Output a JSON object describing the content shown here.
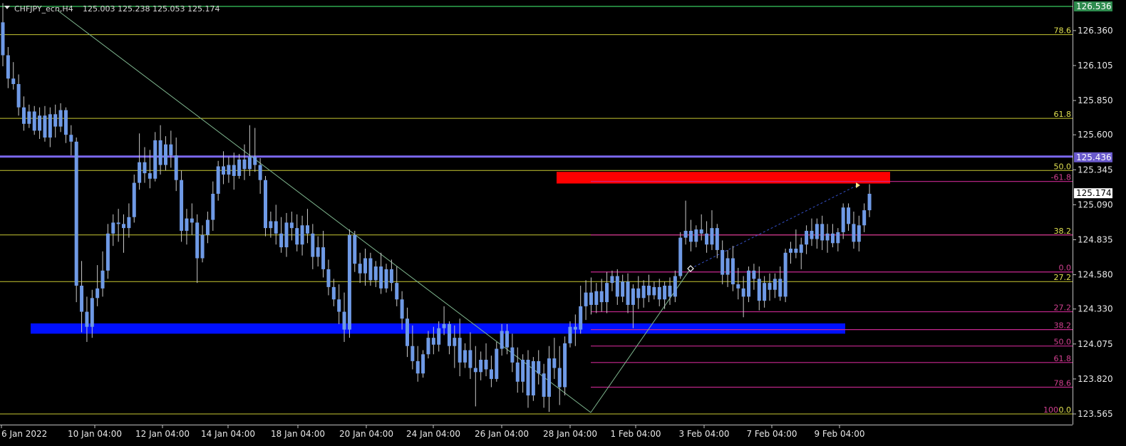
{
  "header": {
    "symbol_label": "CHFJPY_ecn,H4",
    "ohlc_label": "125.003 125.238 125.053 125.174"
  },
  "colors": {
    "background": "#000000",
    "candle_body": "#6f9ae6",
    "candle_wick": "#c8c8c8",
    "fib_yellow": "#c8c832",
    "fib_yellow_text": "#e0e050",
    "fib_magenta": "#c82890",
    "fib_magenta_text": "#d0408f",
    "resistance_line": "#7b68ee",
    "support_zone": "#0010ff",
    "resistance_zone": "#ff0000",
    "top_line": "#2fa84f",
    "trendline": "#7fb78f"
  },
  "price_axis": {
    "ticks": [
      "126.360",
      "126.105",
      "125.850",
      "125.600",
      "125.345",
      "125.090",
      "124.835",
      "124.580",
      "124.330",
      "124.075",
      "123.820",
      "123.565"
    ],
    "tags": [
      {
        "text": "126.536",
        "value": 126.536,
        "bg": "#2e8b4e",
        "fg": "#ffffff"
      },
      {
        "text": "125.436",
        "value": 125.436,
        "bg": "#6a5acd",
        "fg": "#ffffff"
      },
      {
        "text": "125.174",
        "value": 125.174,
        "bg": "#ffffff",
        "fg": "#000000"
      }
    ]
  },
  "time_axis": {
    "labels": [
      "6 Jan 2022",
      "10 Jan 04:00",
      "12 Jan 04:00",
      "14 Jan 04:00",
      "18 Jan 04:00",
      "20 Jan 04:00",
      "24 Jan 04:00",
      "26 Jan 04:00",
      "28 Jan 04:00",
      "1 Feb 04:00",
      "3 Feb 04:00",
      "7 Feb 04:00",
      "9 Feb 04:00"
    ]
  },
  "fib_large": {
    "levels": [
      {
        "label": "78.6",
        "value": 126.33
      },
      {
        "label": "61.8",
        "value": 125.72
      },
      {
        "label": "50.0",
        "value": 125.34
      },
      {
        "label": "38.2",
        "value": 124.87
      },
      {
        "label": "27.2",
        "value": 124.53
      },
      {
        "label": "100",
        "value": 123.565
      },
      {
        "label": "0.0",
        "value": 123.565
      }
    ]
  },
  "fib_small": {
    "levels": [
      {
        "label": "-61.8",
        "value": 125.26
      },
      {
        "label": "38.2",
        "value": 124.87
      },
      {
        "label": "0.0",
        "value": 124.6
      },
      {
        "label": "27.2",
        "value": 124.31
      },
      {
        "label": "38.2",
        "value": 124.18
      },
      {
        "label": "50.0",
        "value": 124.06
      },
      {
        "label": "61.8",
        "value": 123.94
      },
      {
        "label": "78.6",
        "value": 123.76
      }
    ]
  },
  "chart_data": {
    "type": "candlestick",
    "title": "CHFJPY_ecn,H4",
    "current_ohlc": {
      "open": 125.003,
      "high": 125.238,
      "low": 125.053,
      "close": 125.174
    },
    "ylim": [
      123.5,
      126.6
    ],
    "y_ticks": [
      126.36,
      126.105,
      125.85,
      125.6,
      125.345,
      125.09,
      124.835,
      124.58,
      124.33,
      124.075,
      123.82,
      123.565
    ],
    "x_labels": [
      "6 Jan 2022",
      "10 Jan 04:00",
      "12 Jan 04:00",
      "14 Jan 04:00",
      "18 Jan 04:00",
      "20 Jan 04:00",
      "24 Jan 04:00",
      "26 Jan 04:00",
      "28 Jan 04:00",
      "1 Feb 04:00",
      "3 Feb 04:00",
      "7 Feb 04:00",
      "9 Feb 04:00"
    ],
    "horizontal_lines": {
      "top_line": 126.536,
      "resistance_line": 125.436,
      "current_price": 125.174
    },
    "support_zone": {
      "from": 124.15,
      "to": 124.225
    },
    "resistance_zone": {
      "from": 125.245,
      "to": 125.33
    },
    "candles": [
      [
        126.42,
        126.56,
        126.1,
        126.18
      ],
      [
        126.18,
        126.24,
        125.94,
        126.01
      ],
      [
        126.01,
        126.13,
        125.93,
        125.97
      ],
      [
        125.97,
        126.04,
        125.74,
        125.8
      ],
      [
        125.8,
        125.88,
        125.63,
        125.68
      ],
      [
        125.68,
        125.82,
        125.65,
        125.77
      ],
      [
        125.77,
        125.81,
        125.6,
        125.63
      ],
      [
        125.63,
        125.8,
        125.57,
        125.74
      ],
      [
        125.74,
        125.81,
        125.55,
        125.58
      ],
      [
        125.58,
        125.8,
        125.51,
        125.75
      ],
      [
        125.75,
        125.82,
        125.58,
        125.66
      ],
      [
        125.66,
        125.83,
        125.62,
        125.78
      ],
      [
        125.78,
        125.8,
        125.54,
        125.6
      ],
      [
        125.6,
        125.67,
        125.45,
        125.55
      ],
      [
        125.55,
        125.58,
        124.38,
        124.5
      ],
      [
        124.5,
        124.68,
        124.16,
        124.31
      ],
      [
        124.31,
        124.42,
        124.09,
        124.2
      ],
      [
        124.2,
        124.47,
        124.12,
        124.41
      ],
      [
        124.41,
        124.65,
        124.35,
        124.48
      ],
      [
        124.48,
        124.75,
        124.42,
        124.61
      ],
      [
        124.61,
        124.95,
        124.55,
        124.88
      ],
      [
        124.88,
        125.02,
        124.79,
        124.96
      ],
      [
        124.96,
        125.06,
        124.82,
        124.95
      ],
      [
        124.95,
        125.02,
        124.74,
        124.92
      ],
      [
        124.92,
        125.1,
        124.85,
        125.0
      ],
      [
        125.0,
        125.31,
        124.96,
        125.25
      ],
      [
        125.25,
        125.61,
        125.2,
        125.4
      ],
      [
        125.4,
        125.51,
        125.25,
        125.32
      ],
      [
        125.32,
        125.49,
        125.21,
        125.28
      ],
      [
        125.28,
        125.62,
        125.26,
        125.56
      ],
      [
        125.56,
        125.67,
        125.31,
        125.38
      ],
      [
        125.38,
        125.59,
        125.34,
        125.53
      ],
      [
        125.53,
        125.63,
        125.36,
        125.45
      ],
      [
        125.45,
        125.58,
        125.19,
        125.27
      ],
      [
        125.27,
        125.34,
        124.82,
        124.9
      ],
      [
        124.9,
        125.06,
        124.8,
        124.99
      ],
      [
        124.99,
        125.1,
        124.87,
        124.96
      ],
      [
        124.96,
        125.02,
        124.52,
        124.7
      ],
      [
        124.7,
        124.94,
        124.67,
        124.87
      ],
      [
        124.87,
        125.04,
        124.81,
        124.98
      ],
      [
        124.98,
        125.26,
        124.9,
        125.17
      ],
      [
        125.17,
        125.41,
        125.12,
        125.37
      ],
      [
        125.37,
        125.48,
        125.24,
        125.31
      ],
      [
        125.31,
        125.44,
        125.25,
        125.38
      ],
      [
        125.38,
        125.47,
        125.2,
        125.3
      ],
      [
        125.3,
        125.46,
        125.28,
        125.42
      ],
      [
        125.42,
        125.53,
        125.27,
        125.35
      ],
      [
        125.35,
        125.67,
        125.3,
        125.44
      ],
      [
        125.44,
        125.65,
        125.33,
        125.38
      ],
      [
        125.38,
        125.43,
        125.17,
        125.27
      ],
      [
        125.27,
        125.3,
        124.86,
        124.92
      ],
      [
        124.92,
        125.04,
        124.85,
        124.97
      ],
      [
        124.97,
        125.09,
        124.8,
        124.88
      ],
      [
        124.88,
        125.0,
        124.74,
        124.78
      ],
      [
        124.78,
        125.03,
        124.71,
        124.96
      ],
      [
        124.96,
        125.04,
        124.83,
        124.92
      ],
      [
        124.92,
        125.02,
        124.75,
        124.8
      ],
      [
        124.8,
        125.01,
        124.72,
        124.94
      ],
      [
        124.94,
        125.06,
        124.81,
        124.88
      ],
      [
        124.88,
        124.95,
        124.62,
        124.71
      ],
      [
        124.71,
        124.86,
        124.64,
        124.78
      ],
      [
        124.78,
        124.9,
        124.56,
        124.62
      ],
      [
        124.62,
        124.69,
        124.43,
        124.49
      ],
      [
        124.49,
        124.55,
        124.35,
        124.4
      ],
      [
        124.4,
        124.51,
        124.22,
        124.31
      ],
      [
        124.31,
        124.45,
        124.09,
        124.18
      ],
      [
        124.18,
        124.91,
        124.12,
        124.87
      ],
      [
        124.87,
        124.9,
        124.6,
        124.66
      ],
      [
        124.66,
        124.74,
        124.52,
        124.59
      ],
      [
        124.59,
        124.77,
        124.5,
        124.7
      ],
      [
        124.7,
        124.74,
        124.5,
        124.54
      ],
      [
        124.54,
        124.68,
        124.49,
        124.64
      ],
      [
        124.64,
        124.74,
        124.44,
        124.48
      ],
      [
        124.48,
        124.66,
        124.45,
        124.62
      ],
      [
        124.62,
        124.69,
        124.46,
        124.52
      ],
      [
        124.52,
        124.64,
        124.35,
        124.4
      ],
      [
        124.4,
        124.46,
        124.18,
        124.26
      ],
      [
        124.26,
        124.34,
        123.98,
        124.06
      ],
      [
        124.06,
        124.21,
        123.89,
        123.95
      ],
      [
        123.95,
        124.06,
        123.8,
        123.86
      ],
      [
        123.86,
        124.03,
        123.83,
        124.0
      ],
      [
        124.0,
        124.17,
        123.97,
        124.12
      ],
      [
        124.12,
        124.2,
        124.0,
        124.07
      ],
      [
        124.07,
        124.24,
        124.02,
        124.19
      ],
      [
        124.19,
        124.35,
        124.14,
        124.22
      ],
      [
        124.22,
        124.24,
        124.0,
        124.06
      ],
      [
        124.06,
        124.21,
        123.9,
        124.12
      ],
      [
        124.12,
        124.26,
        123.84,
        123.94
      ],
      [
        123.94,
        124.08,
        123.9,
        124.03
      ],
      [
        124.03,
        124.16,
        123.82,
        123.9
      ],
      [
        123.9,
        124.06,
        123.62,
        123.87
      ],
      [
        123.87,
        124.02,
        123.81,
        123.96
      ],
      [
        123.96,
        124.08,
        123.84,
        123.89
      ],
      [
        123.89,
        123.99,
        123.76,
        123.82
      ],
      [
        123.82,
        124.09,
        123.8,
        124.04
      ],
      [
        124.04,
        124.22,
        123.99,
        124.17
      ],
      [
        124.17,
        124.22,
        124.0,
        124.05
      ],
      [
        124.05,
        124.15,
        123.87,
        123.94
      ],
      [
        123.94,
        124.05,
        123.72,
        123.8
      ],
      [
        123.8,
        124.0,
        123.72,
        123.96
      ],
      [
        123.96,
        124.03,
        123.61,
        123.7
      ],
      [
        123.7,
        123.98,
        123.66,
        123.95
      ],
      [
        123.95,
        124.03,
        123.78,
        123.86
      ],
      [
        123.86,
        123.93,
        123.61,
        123.69
      ],
      [
        123.69,
        124.06,
        123.58,
        123.97
      ],
      [
        123.97,
        124.12,
        123.82,
        123.9
      ],
      [
        123.9,
        124.06,
        123.63,
        123.76
      ],
      [
        123.76,
        124.13,
        123.7,
        124.08
      ],
      [
        124.08,
        124.24,
        124.05,
        124.2
      ],
      [
        124.2,
        124.29,
        124.06,
        124.18
      ],
      [
        124.18,
        124.5,
        124.15,
        124.35
      ],
      [
        124.35,
        124.54,
        124.25,
        124.45
      ],
      [
        124.45,
        124.56,
        124.29,
        124.36
      ],
      [
        124.36,
        124.52,
        124.3,
        124.46
      ],
      [
        124.46,
        124.55,
        124.31,
        124.38
      ],
      [
        124.38,
        124.6,
        124.3,
        124.52
      ],
      [
        124.52,
        124.61,
        124.46,
        124.57
      ],
      [
        124.57,
        124.62,
        124.36,
        124.42
      ],
      [
        124.42,
        124.58,
        124.38,
        124.53
      ],
      [
        124.53,
        124.59,
        124.3,
        124.36
      ],
      [
        124.36,
        124.51,
        124.19,
        124.48
      ],
      [
        124.48,
        124.57,
        124.33,
        124.41
      ],
      [
        124.41,
        124.54,
        124.34,
        124.5
      ],
      [
        124.5,
        124.58,
        124.38,
        124.43
      ],
      [
        124.43,
        124.53,
        124.4,
        124.49
      ],
      [
        124.49,
        124.55,
        124.35,
        124.4
      ],
      [
        124.4,
        124.53,
        124.33,
        124.5
      ],
      [
        124.5,
        124.56,
        124.36,
        124.42
      ],
      [
        124.42,
        124.61,
        124.38,
        124.57
      ],
      [
        124.57,
        124.89,
        124.55,
        124.85
      ],
      [
        124.85,
        125.12,
        124.8,
        124.9
      ],
      [
        124.9,
        124.98,
        124.75,
        124.82
      ],
      [
        124.82,
        124.94,
        124.78,
        124.91
      ],
      [
        124.91,
        125.02,
        124.83,
        124.88
      ],
      [
        124.88,
        124.97,
        124.74,
        124.8
      ],
      [
        124.8,
        125.05,
        124.76,
        124.92
      ],
      [
        124.92,
        124.95,
        124.7,
        124.76
      ],
      [
        124.76,
        124.83,
        124.51,
        124.58
      ],
      [
        124.58,
        124.76,
        124.49,
        124.7
      ],
      [
        124.7,
        124.79,
        124.46,
        124.51
      ],
      [
        124.51,
        124.63,
        124.4,
        124.48
      ],
      [
        124.48,
        124.57,
        124.27,
        124.42
      ],
      [
        124.42,
        124.64,
        124.38,
        124.61
      ],
      [
        124.61,
        124.66,
        124.47,
        124.55
      ],
      [
        124.55,
        124.64,
        124.32,
        124.39
      ],
      [
        124.39,
        124.57,
        124.34,
        124.52
      ],
      [
        124.52,
        124.59,
        124.39,
        124.47
      ],
      [
        124.47,
        124.59,
        124.41,
        124.55
      ],
      [
        124.55,
        124.64,
        124.39,
        124.42
      ],
      [
        124.42,
        124.77,
        124.38,
        124.74
      ],
      [
        124.74,
        124.82,
        124.66,
        124.77
      ],
      [
        124.77,
        124.91,
        124.7,
        124.74
      ],
      [
        124.74,
        124.85,
        124.62,
        124.8
      ],
      [
        124.8,
        124.94,
        124.73,
        124.9
      ],
      [
        124.9,
        124.99,
        124.79,
        124.84
      ],
      [
        124.84,
        124.99,
        124.77,
        124.95
      ],
      [
        124.95,
        125.01,
        124.76,
        124.83
      ],
      [
        124.83,
        124.95,
        124.74,
        124.88
      ],
      [
        124.88,
        124.95,
        124.78,
        124.81
      ],
      [
        124.81,
        124.92,
        124.75,
        124.89
      ],
      [
        124.89,
        125.1,
        124.84,
        125.07
      ],
      [
        125.07,
        125.1,
        124.9,
        124.95
      ],
      [
        124.95,
        125.04,
        124.77,
        124.82
      ],
      [
        124.82,
        125.01,
        124.75,
        124.94
      ],
      [
        124.94,
        125.1,
        124.89,
        125.05
      ],
      [
        125.05,
        125.24,
        125.0,
        125.17
      ]
    ]
  }
}
